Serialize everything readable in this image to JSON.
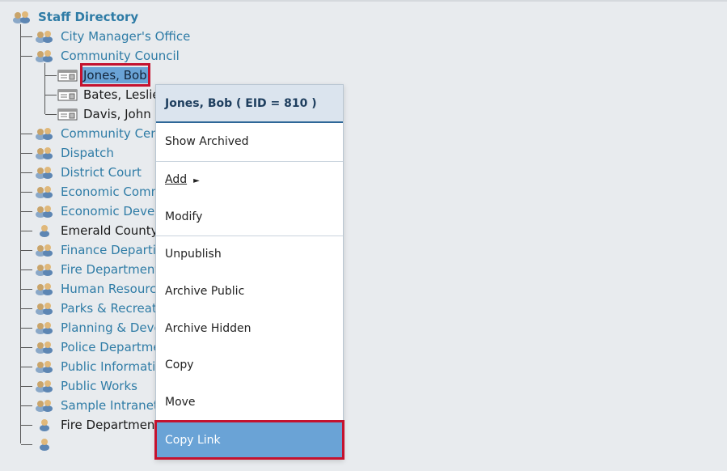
{
  "tree": {
    "root": {
      "label": "Staff Directory",
      "icon": "multi-user-icon"
    },
    "departments": [
      {
        "label": "City Manager's Office",
        "style": "link"
      },
      {
        "label": "Community Council",
        "style": "link",
        "expanded": true,
        "people": [
          {
            "label": "Jones, Bob",
            "selected": true
          },
          {
            "label": "Bates, Leslie"
          },
          {
            "label": "Davis, John"
          }
        ]
      },
      {
        "label": "Community Cen",
        "style": "link"
      },
      {
        "label": "Dispatch",
        "style": "link"
      },
      {
        "label": "District Court",
        "style": "link"
      },
      {
        "label": "Economic Comm",
        "style": "link"
      },
      {
        "label": "Economic Devel",
        "style": "link"
      },
      {
        "label": "Emerald County",
        "style": "plain"
      },
      {
        "label": "Finance Departi",
        "style": "link"
      },
      {
        "label": "Fire Department",
        "style": "link"
      },
      {
        "label": "Human Resourc",
        "style": "link"
      },
      {
        "label": "Parks & Recreat",
        "style": "link"
      },
      {
        "label": "Planning & Deve",
        "style": "link"
      },
      {
        "label": "Police Departme",
        "style": "link"
      },
      {
        "label": "Public Informati",
        "style": "link"
      },
      {
        "label": "Public Works",
        "style": "link"
      },
      {
        "label": "Sample Intranet",
        "style": "link"
      },
      {
        "label": "Fire Departmen",
        "style": "plain"
      },
      {
        "label": "",
        "style": "plain"
      }
    ]
  },
  "context_menu": {
    "header": "Jones, Bob ( EID = 810 )",
    "items": {
      "show_archived": "Show Archived",
      "add": "Add",
      "add_arrow": "►",
      "modify": "Modify",
      "unpublish": "Unpublish",
      "archive_public": "Archive Public",
      "archive_hidden": "Archive Hidden",
      "copy": "Copy",
      "move": "Move",
      "copy_link": "Copy Link"
    }
  },
  "colors": {
    "link": "#2f7ca6",
    "selection": "#6aa3d6",
    "highlight_border": "#c4122f",
    "menu_header_bg": "#dbe4ee",
    "menu_header_border": "#2e6798"
  }
}
